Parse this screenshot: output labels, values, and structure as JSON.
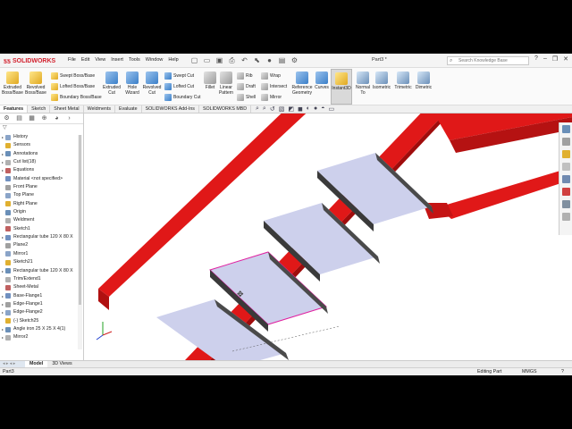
{
  "app": {
    "brand": "SOLIDWORKS",
    "doc_title": "Part3 *",
    "menu": [
      "File",
      "Edit",
      "View",
      "Insert",
      "Tools",
      "Window",
      "Help"
    ],
    "search_placeholder": "Search Knowledge Base"
  },
  "commands": {
    "extruded_boss": "Extruded Boss/Base",
    "revolved_boss": "Revolved Boss/Base",
    "swept_boss": "Swept Boss/Base",
    "lofted_boss": "Lofted Boss/Base",
    "boundary_boss": "Boundary Boss/Base",
    "extruded_cut": "Extruded Cut",
    "hole_wizard": "Hole Wizard",
    "revolved_cut": "Revolved Cut",
    "swept_cut": "Swept Cut",
    "lofted_cut": "Lofted Cut",
    "boundary_cut": "Boundary Cut",
    "fillet": "Fillet",
    "linear_pattern": "Linear Pattern",
    "rib": "Rib",
    "draft": "Draft",
    "shell": "Shell",
    "wrap": "Wrap",
    "intersect": "Intersect",
    "mirror": "Mirror",
    "reference_geometry": "Reference Geometry",
    "curves": "Curves",
    "instant3d": "Instant3D",
    "normal_to": "Normal To",
    "isometric": "Isometric",
    "trimetric": "Trimetric",
    "dimetric": "Dimetric"
  },
  "tabs": [
    "Features",
    "Sketch",
    "Sheet Metal",
    "Weldments",
    "Evaluate",
    "SOLIDWORKS Add-Ins",
    "SOLIDWORKS MBD"
  ],
  "tree": [
    {
      "label": "History",
      "expand": "▸"
    },
    {
      "label": "Sensors",
      "expand": ""
    },
    {
      "label": "Annotations",
      "expand": "▸"
    },
    {
      "label": "Cut list(18)",
      "expand": "▸"
    },
    {
      "label": "Equations",
      "expand": "▸"
    },
    {
      "label": "Material <not specified>",
      "expand": ""
    },
    {
      "label": "Front Plane",
      "expand": ""
    },
    {
      "label": "Top Plane",
      "expand": ""
    },
    {
      "label": "Right Plane",
      "expand": ""
    },
    {
      "label": "Origin",
      "expand": ""
    },
    {
      "label": "Weldment",
      "expand": ""
    },
    {
      "label": "Sketch1",
      "expand": ""
    },
    {
      "label": "Rectangular tube 120 X 80 X",
      "expand": "▸"
    },
    {
      "label": "Plane2",
      "expand": ""
    },
    {
      "label": "Mirror1",
      "expand": ""
    },
    {
      "label": "Sketch21",
      "expand": ""
    },
    {
      "label": "Rectangular tube 120 X 80 X",
      "expand": "▸"
    },
    {
      "label": "Trim/Extend1",
      "expand": ""
    },
    {
      "label": "Sheet-Metal",
      "expand": ""
    },
    {
      "label": "Base-Flange1",
      "expand": "▸"
    },
    {
      "label": "Edge-Flange1",
      "expand": "▸"
    },
    {
      "label": "Edge-Flange2",
      "expand": "▸"
    },
    {
      "label": "(-) Sketch25",
      "expand": ""
    },
    {
      "label": "Angle iron 25 X 25 X 4(1)",
      "expand": "▸"
    },
    {
      "label": "Mirror2",
      "expand": "▸"
    }
  ],
  "model_tabs": [
    "Model",
    "3D Views"
  ],
  "status": {
    "doc": "Part3",
    "mode": "Editing Part",
    "units": "MMGS"
  },
  "colors": {
    "frame": "#e01818",
    "frame_dark": "#9a0c0c",
    "step_top": "#cdd0ec",
    "step_side": "#4a4a4a",
    "brand_red": "#d21f2c"
  }
}
